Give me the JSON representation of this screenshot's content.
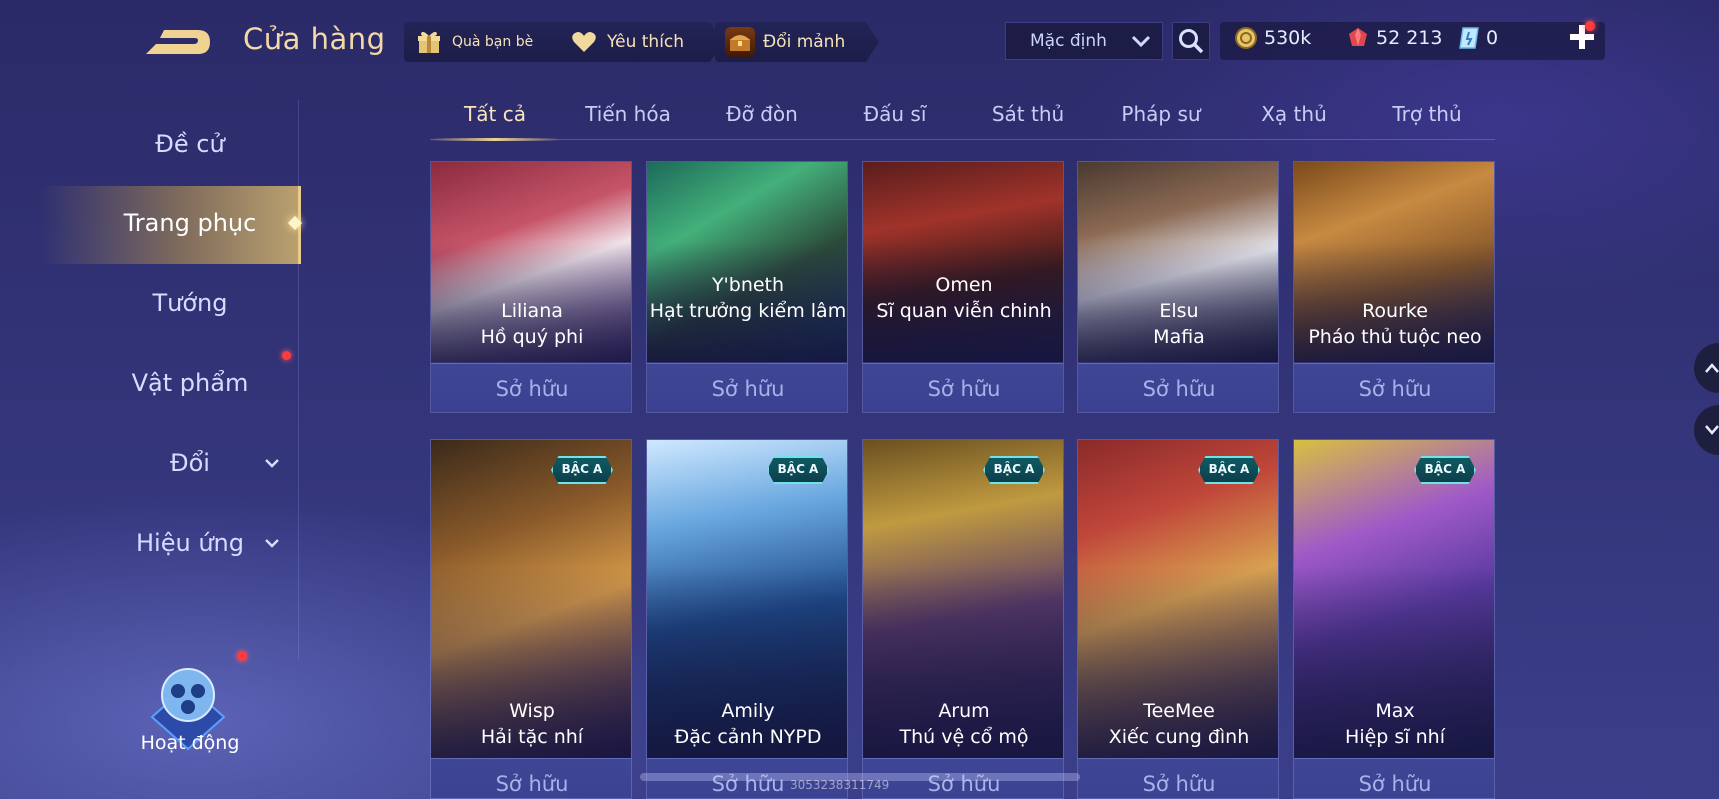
{
  "header": {
    "title": "Cửa hàng",
    "gift_label": "Quà bạn bè",
    "favorite_label": "Yêu thích",
    "exchange_label": "Đổi mảnh",
    "sort_value": "Mặc định"
  },
  "currency": {
    "gold": "530k",
    "ruby": "52 213",
    "voucher": "0"
  },
  "sidebar": {
    "items": [
      {
        "label": "Đề cử"
      },
      {
        "label": "Trang phục"
      },
      {
        "label": "Tướng"
      },
      {
        "label": "Vật phẩm"
      },
      {
        "label": "Đổi"
      },
      {
        "label": "Hiệu ứng"
      }
    ],
    "event_label": "Hoạt động"
  },
  "tabs": [
    {
      "label": "Tất cả"
    },
    {
      "label": "Tiến hóa"
    },
    {
      "label": "Đỡ đòn"
    },
    {
      "label": "Đấu sĩ"
    },
    {
      "label": "Sát thủ"
    },
    {
      "label": "Pháp sư"
    },
    {
      "label": "Xạ thủ"
    },
    {
      "label": "Trợ thủ"
    }
  ],
  "owned_label": "Sở hữu",
  "badge_label": "BẬC A",
  "row1": [
    {
      "hero": "Liliana",
      "skin": "Hồ quý phi"
    },
    {
      "hero": "Y'bneth",
      "skin": "Hạt trưởng kiểm lâm"
    },
    {
      "hero": "Omen",
      "skin": "Sĩ quan viễn chinh"
    },
    {
      "hero": "Elsu",
      "skin": "Mafia"
    },
    {
      "hero": "Rourke",
      "skin": "Pháo thủ tuộc neo"
    }
  ],
  "row2": [
    {
      "hero": "Wisp",
      "skin": "Hải tặc nhí"
    },
    {
      "hero": "Amily",
      "skin": "Đặc cảnh NYPD"
    },
    {
      "hero": "Arum",
      "skin": "Thú vệ cổ mộ"
    },
    {
      "hero": "TeeMee",
      "skin": "Xiếc cung đình"
    },
    {
      "hero": "Max",
      "skin": "Hiệp sĩ nhí"
    }
  ],
  "watermark": "3053238311749",
  "colors": {
    "accent_gold": "#f0d293",
    "badge_teal": "#6fe3e6",
    "notification_red": "#ff3b3b"
  }
}
